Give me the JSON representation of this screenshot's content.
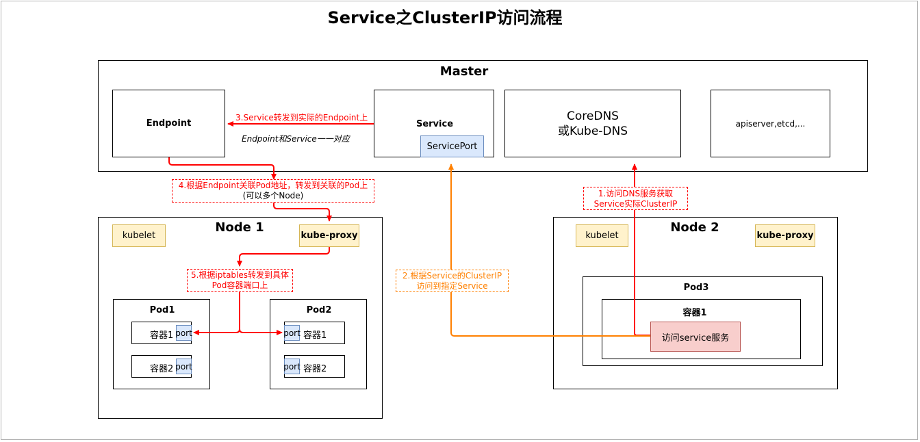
{
  "title": "Service之ClusterIP访问流程",
  "master": {
    "title": "Master",
    "endpoint": "Endpoint",
    "service": "Service",
    "service_port": "ServicePort",
    "coredns_line1": "CoreDNS",
    "coredns_line2": "或Kube-DNS",
    "apiserver": "apiserver,etcd,...",
    "endpoint_service_note": "Endpoint和Service一一对应"
  },
  "node1": {
    "title": "Node 1",
    "kubelet": "kubelet",
    "kube_proxy": "kube-proxy",
    "pod1": {
      "title": "Pod1",
      "containers": [
        "容器1",
        "容器2"
      ]
    },
    "pod2": {
      "title": "Pod2",
      "containers": [
        "容器1",
        "容器2"
      ]
    },
    "port_label": "port"
  },
  "node2": {
    "title": "Node 2",
    "kubelet": "kubelet",
    "kube_proxy": "kube-proxy",
    "pod3": "Pod3",
    "container1": "容器1",
    "access_service": "访问service服务"
  },
  "steps": {
    "step1_line1": "1.访问DNS服务获取",
    "step1_line2": "Service实际ClusterIP",
    "step2_line1": "2.根据Service的ClusterIP",
    "step2_line2": "访问到指定Service",
    "step3": "3.Service转发到实际的Endpoint上",
    "step4_line1": "4.根据Endpoint关联Pod地址，转发到关联的Pod上",
    "step4_line2": "(可以多个Node)",
    "step5_line1": "5.根据iptables转发到具体",
    "step5_line2": "Pod容器端口上"
  },
  "colors": {
    "red_arrow": "#ff0000",
    "orange_arrow": "#ff8000",
    "yellow_fill": "#fff2cc",
    "blue_fill": "#dae8fc",
    "pink_fill": "#f8cecc"
  }
}
